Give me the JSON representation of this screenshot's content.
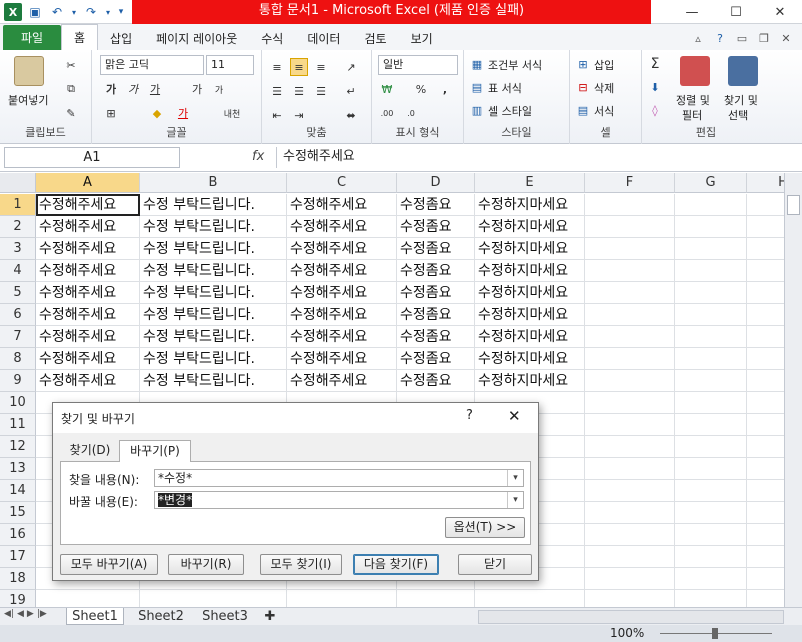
{
  "window": {
    "title": "통합 문서1  -  Microsoft Excel (제품 인증 실패)",
    "minimize": "—",
    "maximize": "☐",
    "close": "✕"
  },
  "ribbon": {
    "tabs": [
      "파일",
      "홈",
      "삽입",
      "페이지 레이아웃",
      "수식",
      "데이터",
      "검토",
      "보기"
    ],
    "active_tab": "홈",
    "clipboard": {
      "paste": "붙여넣기",
      "label": "클립보드"
    },
    "font": {
      "name": "맑은 고딕",
      "size": "11",
      "bold": "가",
      "italic": "가",
      "underline": "가",
      "grow": "가",
      "shrink": "가",
      "phonetic": "내천",
      "label": "글꼴"
    },
    "alignment": {
      "label": "맞춤"
    },
    "number": {
      "format": "일반",
      "percent": "%",
      "comma": ",",
      "label": "표시 형식"
    },
    "styles": {
      "conditional": "조건부 서식",
      "table": "표 서식",
      "cell": "셀 스타일",
      "label": "스타일"
    },
    "cells": {
      "insert": "삽입",
      "delete": "삭제",
      "format": "서식",
      "label": "셀"
    },
    "editing": {
      "sort": "정렬 및",
      "sort2": "필터",
      "find": "찾기 및",
      "find2": "선택",
      "label": "편집"
    }
  },
  "formula_bar": {
    "name_box": "A1",
    "fx": "fx",
    "content": "수정해주세요"
  },
  "grid": {
    "columns": [
      "A",
      "B",
      "C",
      "D",
      "E",
      "F",
      "G",
      "H"
    ],
    "rows": [
      "1",
      "2",
      "3",
      "4",
      "5",
      "6",
      "7",
      "8",
      "9",
      "10",
      "11",
      "12",
      "13",
      "14",
      "15",
      "16",
      "17",
      "18",
      "19"
    ],
    "cells": [
      [
        "수정해주세요",
        "수정 부탁드립니다.",
        "수정해주세요",
        "수정좀요",
        "수정하지마세요"
      ],
      [
        "수정해주세요",
        "수정 부탁드립니다.",
        "수정해주세요",
        "수정좀요",
        "수정하지마세요"
      ],
      [
        "수정해주세요",
        "수정 부탁드립니다.",
        "수정해주세요",
        "수정좀요",
        "수정하지마세요"
      ],
      [
        "수정해주세요",
        "수정 부탁드립니다.",
        "수정해주세요",
        "수정좀요",
        "수정하지마세요"
      ],
      [
        "수정해주세요",
        "수정 부탁드립니다.",
        "수정해주세요",
        "수정좀요",
        "수정하지마세요"
      ],
      [
        "수정해주세요",
        "수정 부탁드립니다.",
        "수정해주세요",
        "수정좀요",
        "수정하지마세요"
      ],
      [
        "수정해주세요",
        "수정 부탁드립니다.",
        "수정해주세요",
        "수정좀요",
        "수정하지마세요"
      ],
      [
        "수정해주세요",
        "수정 부탁드립니다.",
        "수정해주세요",
        "수정좀요",
        "수정하지마세요"
      ],
      [
        "수정해주세요",
        "수정 부탁드립니다.",
        "수정해주세요",
        "수정좀요",
        "수정하지마세요"
      ]
    ]
  },
  "sheets": [
    "Sheet1",
    "Sheet2",
    "Sheet3"
  ],
  "active_sheet": "Sheet1",
  "status": {
    "zoom": "100%"
  },
  "dialog": {
    "title": "찾기 및 바꾸기",
    "help": "?",
    "close": "✕",
    "tab_find": "찾기(D)",
    "tab_replace": "바꾸기(P)",
    "find_label": "찾을 내용(N):",
    "find_value": "*수정*",
    "replace_label": "바꿀 내용(E):",
    "replace_value": "*변경*",
    "options_button": "옵션(T) >>",
    "replace_all": "모두 바꾸기(A)",
    "replace": "바꾸기(R)",
    "find_all": "모두 찾기(I)",
    "find_next": "다음 찾기(F)",
    "close_button": "닫기"
  },
  "colors": {
    "title_accent": "#ee1111",
    "file_tab": "#2a8c3f",
    "selection_header": "#f8d88a"
  }
}
